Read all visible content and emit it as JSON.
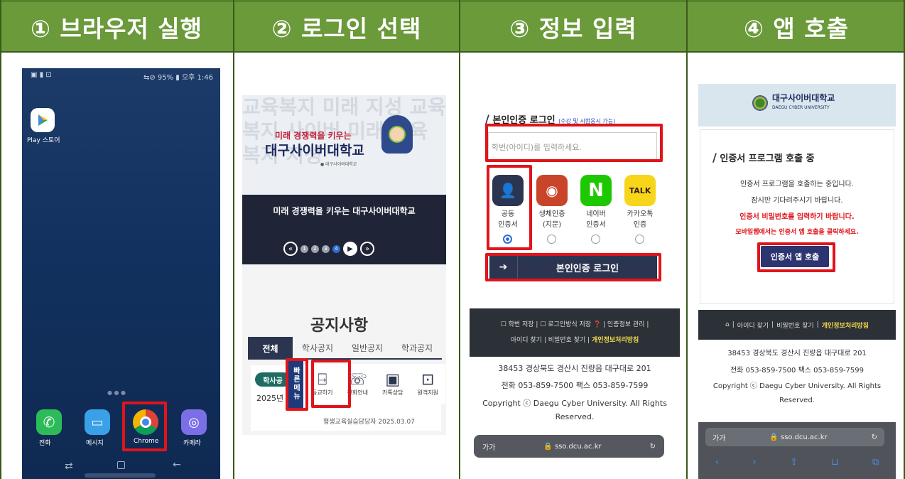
{
  "steps": [
    "① 브라우저 실행",
    "② 로그인 선택",
    "③ 정보 입력",
    "④ 앱 호출"
  ],
  "p1": {
    "status_left": "▣ ▮ ⊡",
    "status_right": "⇆⊘ 95% ▮ 오후 1:46",
    "play_label": "Play 스토어",
    "dock": [
      "전화",
      "메시지",
      "Chrome",
      "카메라"
    ]
  },
  "p2": {
    "banner_line1": "미래 경쟁력을 키우는",
    "banner_line2": "대구사이버대학교",
    "banner_small": "● 대구사이버대학교",
    "caption": "미래 경쟁력을 키우는 대구사이버대학교",
    "notice_title": "공지사항",
    "tabs": [
      "전체",
      "학사공지",
      "일반공지",
      "학과공지"
    ],
    "quick_menu": "빠른메뉴",
    "quick_items": [
      "등교하기",
      "전화안내",
      "카톡상담",
      "원격지원"
    ],
    "tag": "학사공",
    "year": "2025년",
    "author": "평생교육실습담당자 2025.03.07"
  },
  "p3": {
    "title": "본인인증 로그인",
    "title_note": "(수강 및 시험응시 가능)",
    "placeholder": "학번(아이디)를 입력하세요.",
    "methods": [
      "공동\n인증서",
      "생체인증\n(지문)",
      "네이버\n인증서",
      "카카오톡\n인증"
    ],
    "login_button": "본인인증 로그인",
    "opt1": "학번 저장",
    "opt2": "로그인방식 저장",
    "opt3": "인증정보 관리",
    "link1": "아이디 찾기",
    "link2": "비밀번호 찾기",
    "link3": "개인정보처리방침",
    "addr": "38453 경상북도 경산시 진량읍 대구대로 201",
    "tel": "전화 053-859-7500 팩스 053-859-7599",
    "copy": "Copyright ⓒ Daegu Cyber University. All Rights Reserved.",
    "url_left": "가가",
    "url": "sso.dcu.ac.kr"
  },
  "p4": {
    "logo_kr": "대구사이버대학교",
    "logo_en": "DAEGU CYBER UNIVERSITY",
    "title": "인증서 프로그램 호출 중",
    "l1": "인증서 프로그램을 호출하는 중입니다.",
    "l2": "잠시만 기다려주시기 바랍니다.",
    "l3": "인증서 비밀번호를 입력하기 바랍니다.",
    "l4": "모바일웹에서는 인증서 앱 호출을 클릭하세요.",
    "button": "인증서 앱 호출",
    "link1": "아이디 찾기",
    "link2": "비밀번호 찾기",
    "link3": "개인정보처리방침",
    "addr": "38453 경상북도 경산시 진량읍 대구대로 201",
    "tel": "전화 053-859-7500 팩스 053-859-7599",
    "copy": "Copyright ⓒ Daegu Cyber University. All Rights Reserved.",
    "url_left": "가가",
    "url": "sso.dcu.ac.kr"
  },
  "colors": {
    "header": "#6b9a3a",
    "highlight": "#e0141b",
    "navy": "#2c3550",
    "p4_red": "#e0141b"
  }
}
